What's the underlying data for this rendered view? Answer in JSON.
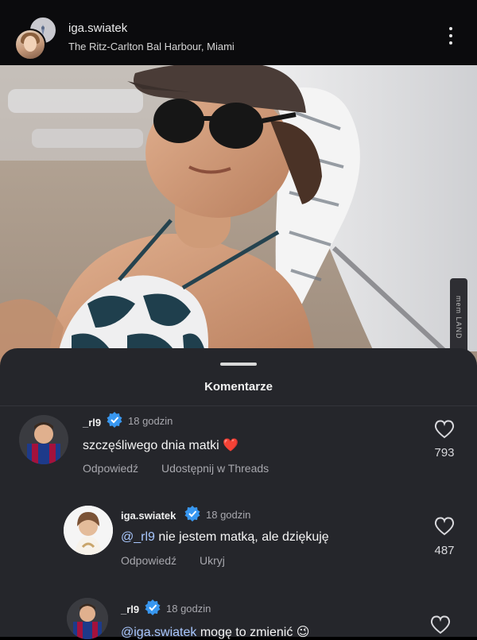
{
  "header": {
    "username": "iga.swiatek",
    "location": "The Ritz-Carlton Bal Harbour, Miami"
  },
  "sheet": {
    "title": "Komentarze"
  },
  "comments": [
    {
      "username": "_rl9",
      "time": "18 godzin",
      "text_mention": "",
      "text": "szczęśliwego dnia matki ❤️",
      "reply_label": "Odpowiedź",
      "extra_action": "Udostępnij w Threads",
      "likes": "793"
    },
    {
      "username": "iga.swiatek",
      "time": "18 godzin",
      "text_mention": "@_rl9",
      "text": " nie jestem matką, ale dziękuję",
      "reply_label": "Odpowiedź",
      "extra_action": "Ukryj",
      "likes": "487"
    },
    {
      "username": "_rl9",
      "time": "18 godzin",
      "text_mention": "@iga.swiatek",
      "text": " mogę to zmienić 😉",
      "likes": ""
    }
  ],
  "watermark": "mem LAND",
  "colors": {
    "sheet_bg": "#25262b",
    "verified": "#3897f0",
    "mention": "#a9c8ff"
  }
}
